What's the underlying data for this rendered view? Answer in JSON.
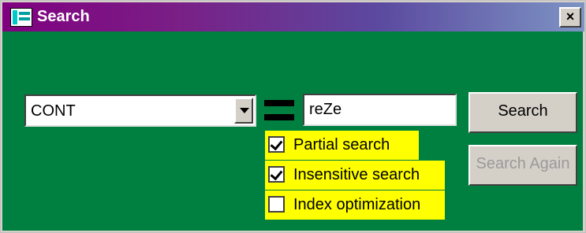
{
  "window": {
    "title": "Search",
    "close_label": "×"
  },
  "form": {
    "field_select": {
      "value": "CONT"
    },
    "operator": "=",
    "query_input": {
      "value": "reZe"
    },
    "search_button": "Search",
    "search_again_button": "Search Again",
    "options": [
      {
        "label": "Partial search",
        "checked": true
      },
      {
        "label": "Insensitive search",
        "checked": true
      },
      {
        "label": "Index optimization",
        "checked": false
      }
    ]
  },
  "colors": {
    "body_background": "#008040",
    "option_highlight": "#ffff00",
    "titlebar_start": "#800080",
    "titlebar_end": "#7d94c4",
    "disabled_text": "#9a9a9a"
  },
  "icons": {
    "title": "search-window-icon",
    "close": "close-icon",
    "dropdown": "chevron-down-icon",
    "operator": "equals-icon",
    "checkbox": "checkmark-icon"
  }
}
